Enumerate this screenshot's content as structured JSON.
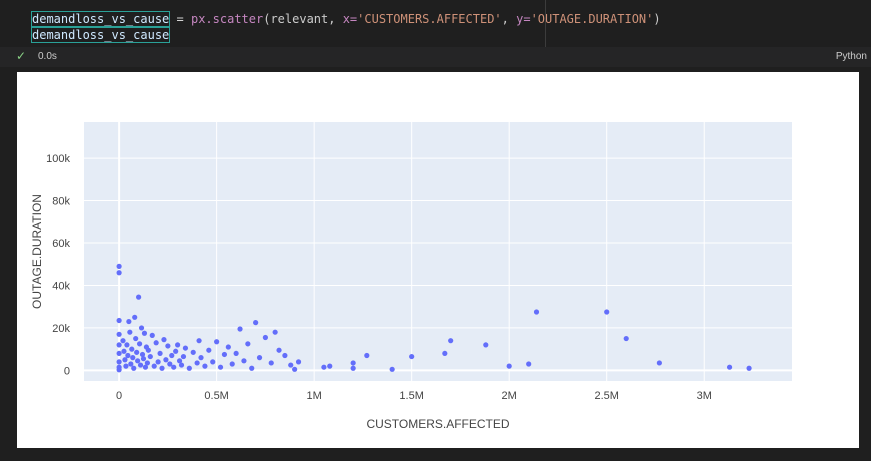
{
  "code": {
    "line1": {
      "var": "demandloss_vs_cause",
      "assign": " = ",
      "call": "px.scatter",
      "args_open": "(relevant, ",
      "x_kw": "x=",
      "x_val": "'CUSTOMERS.AFFECTED'",
      "comma": ", ",
      "y_kw": "y=",
      "y_val": "'OUTAGE.DURATION'",
      "close": ")"
    },
    "line2": "demandloss_vs_cause"
  },
  "status": {
    "elapsed": "0.0s",
    "language": "Python"
  },
  "colors": {
    "marker": "#636efa",
    "plot_bg": "#e5ecf6",
    "grid": "#ffffff"
  },
  "chart_data": {
    "type": "scatter",
    "xlabel": "CUSTOMERS.AFFECTED",
    "ylabel": "OUTAGE.DURATION",
    "xlim": [
      -180000,
      3450000
    ],
    "ylim": [
      -5000,
      117000
    ],
    "x_ticks": [
      {
        "value": 0,
        "label": "0"
      },
      {
        "value": 500000,
        "label": "0.5M"
      },
      {
        "value": 1000000,
        "label": "1M"
      },
      {
        "value": 1500000,
        "label": "1.5M"
      },
      {
        "value": 2000000,
        "label": "2M"
      },
      {
        "value": 2500000,
        "label": "2.5M"
      },
      {
        "value": 3000000,
        "label": "3M"
      }
    ],
    "y_ticks": [
      {
        "value": 0,
        "label": "0"
      },
      {
        "value": 20000,
        "label": "20k"
      },
      {
        "value": 40000,
        "label": "40k"
      },
      {
        "value": 60000,
        "label": "60k"
      },
      {
        "value": 80000,
        "label": "80k"
      },
      {
        "value": 100000,
        "label": "100k"
      }
    ],
    "grid": true,
    "points": [
      [
        0,
        49000
      ],
      [
        0,
        46000
      ],
      [
        0,
        23500
      ],
      [
        0,
        17000
      ],
      [
        0,
        12000
      ],
      [
        0,
        8000
      ],
      [
        0,
        4000
      ],
      [
        0,
        1500
      ],
      [
        0,
        300
      ],
      [
        20000,
        14000
      ],
      [
        25000,
        9000
      ],
      [
        30000,
        5000
      ],
      [
        35000,
        2000
      ],
      [
        40000,
        12000
      ],
      [
        45000,
        7000
      ],
      [
        50000,
        23000
      ],
      [
        55000,
        18000
      ],
      [
        60000,
        3000
      ],
      [
        65000,
        10000
      ],
      [
        70000,
        6000
      ],
      [
        75000,
        1000
      ],
      [
        80000,
        25000
      ],
      [
        85000,
        15000
      ],
      [
        90000,
        8500
      ],
      [
        95000,
        4500
      ],
      [
        100000,
        34500
      ],
      [
        105000,
        12500
      ],
      [
        110000,
        2500
      ],
      [
        115000,
        20000
      ],
      [
        120000,
        7500
      ],
      [
        125000,
        5500
      ],
      [
        130000,
        17500
      ],
      [
        135000,
        1500
      ],
      [
        140000,
        11000
      ],
      [
        145000,
        3500
      ],
      [
        150000,
        9500
      ],
      [
        160000,
        6500
      ],
      [
        170000,
        16500
      ],
      [
        180000,
        2000
      ],
      [
        190000,
        13000
      ],
      [
        200000,
        4000
      ],
      [
        210000,
        8000
      ],
      [
        220000,
        1000
      ],
      [
        230000,
        14500
      ],
      [
        240000,
        5000
      ],
      [
        250000,
        11500
      ],
      [
        260000,
        3000
      ],
      [
        270000,
        7000
      ],
      [
        280000,
        1500
      ],
      [
        290000,
        9000
      ],
      [
        300000,
        12000
      ],
      [
        310000,
        4500
      ],
      [
        320000,
        2500
      ],
      [
        330000,
        6500
      ],
      [
        340000,
        10500
      ],
      [
        360000,
        1000
      ],
      [
        380000,
        8500
      ],
      [
        400000,
        3500
      ],
      [
        410000,
        14000
      ],
      [
        420000,
        6000
      ],
      [
        440000,
        2000
      ],
      [
        460000,
        9500
      ],
      [
        480000,
        4000
      ],
      [
        500000,
        13500
      ],
      [
        520000,
        1500
      ],
      [
        540000,
        7500
      ],
      [
        560000,
        11000
      ],
      [
        580000,
        3000
      ],
      [
        600000,
        8000
      ],
      [
        620000,
        19500
      ],
      [
        640000,
        4500
      ],
      [
        660000,
        12500
      ],
      [
        680000,
        1000
      ],
      [
        700000,
        22500
      ],
      [
        720000,
        6000
      ],
      [
        750000,
        15500
      ],
      [
        780000,
        3500
      ],
      [
        800000,
        18000
      ],
      [
        820000,
        9500
      ],
      [
        850000,
        7000
      ],
      [
        880000,
        2500
      ],
      [
        900000,
        500
      ],
      [
        920000,
        4000
      ],
      [
        1050000,
        1500
      ],
      [
        1080000,
        2000
      ],
      [
        1200000,
        1000
      ],
      [
        1200000,
        3500
      ],
      [
        1270000,
        7000
      ],
      [
        1400000,
        500
      ],
      [
        1500000,
        6500
      ],
      [
        1670000,
        8000
      ],
      [
        1700000,
        14000
      ],
      [
        1880000,
        12000
      ],
      [
        2000000,
        2000
      ],
      [
        2100000,
        3000
      ],
      [
        2140000,
        27500
      ],
      [
        2500000,
        27500
      ],
      [
        2600000,
        15000
      ],
      [
        2770000,
        3500
      ],
      [
        3130000,
        1500
      ],
      [
        3230000,
        1000
      ]
    ]
  }
}
